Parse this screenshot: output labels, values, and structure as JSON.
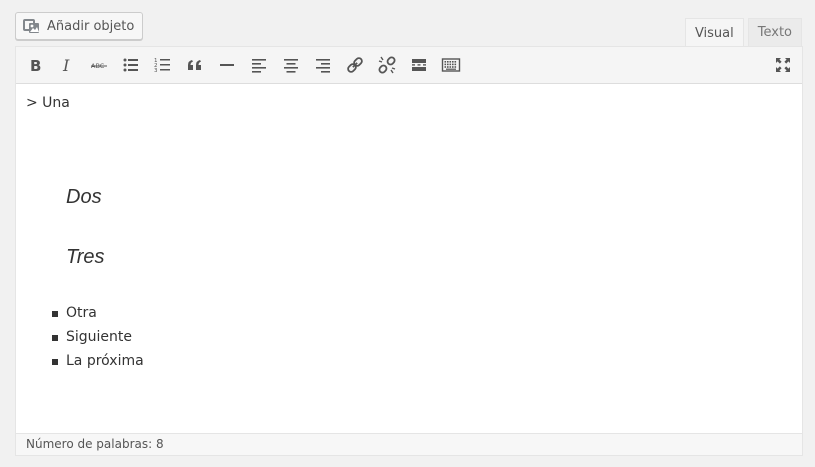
{
  "media": {
    "button_label": "Añadir objeto",
    "icon": "add-media-icon"
  },
  "tabs": [
    {
      "label": "Visual",
      "active": true
    },
    {
      "label": "Texto",
      "active": false
    }
  ],
  "toolbar": {
    "buttons": [
      {
        "name": "bold",
        "icon": "bold-icon"
      },
      {
        "name": "italic",
        "icon": "italic-icon"
      },
      {
        "name": "strikethrough",
        "icon": "strikethrough-icon"
      },
      {
        "name": "bulleted-list",
        "icon": "bulleted-list-icon"
      },
      {
        "name": "numbered-list",
        "icon": "numbered-list-icon"
      },
      {
        "name": "blockquote",
        "icon": "blockquote-icon"
      },
      {
        "name": "horizontal-line",
        "icon": "horizontal-line-icon"
      },
      {
        "name": "align-left",
        "icon": "align-left-icon"
      },
      {
        "name": "align-center",
        "icon": "align-center-icon"
      },
      {
        "name": "align-right",
        "icon": "align-right-icon"
      },
      {
        "name": "insert-link",
        "icon": "link-icon"
      },
      {
        "name": "remove-link",
        "icon": "unlink-icon"
      },
      {
        "name": "read-more",
        "icon": "read-more-icon"
      },
      {
        "name": "toolbar-toggle",
        "icon": "keyboard-icon"
      },
      {
        "name": "fullscreen",
        "icon": "fullscreen-icon"
      }
    ]
  },
  "content": {
    "first_line": "> Una",
    "quotes": [
      "Dos",
      "Tres"
    ],
    "list_items": [
      "Otra",
      "Siguiente",
      "La próxima"
    ]
  },
  "status": {
    "word_count_text": "Número de palabras: 8"
  }
}
